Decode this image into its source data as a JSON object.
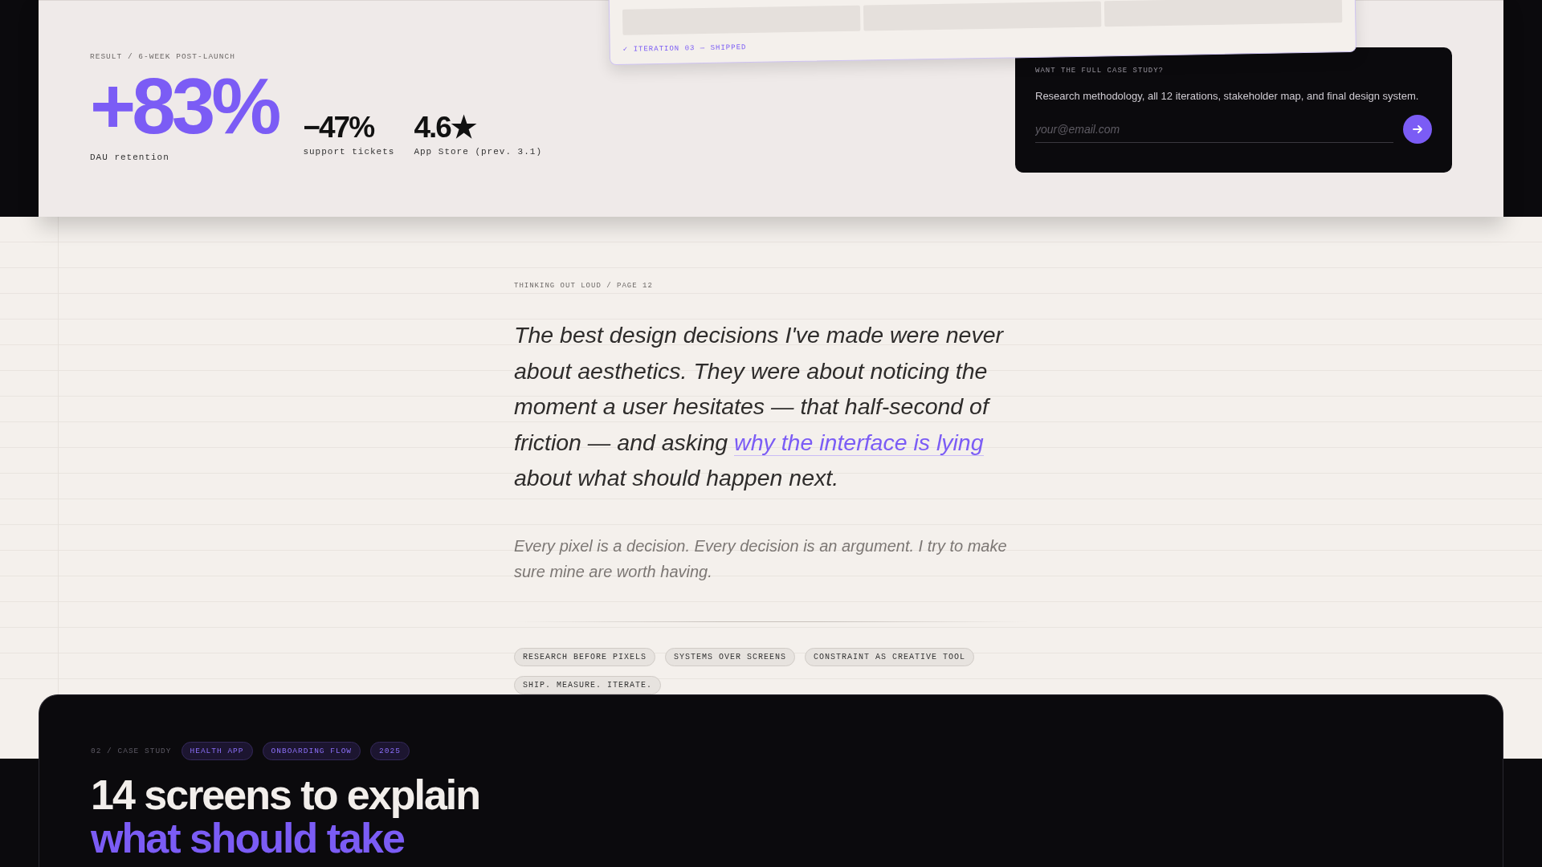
{
  "result": {
    "label": "RESULT / 6-WEEK POST-LAUNCH",
    "headline": {
      "value": "+83%",
      "caption": "DAU retention"
    },
    "stats": [
      {
        "value": "−47%",
        "caption": "support tickets"
      },
      {
        "value": "4.6★",
        "caption": "App Store (prev. 3.1)"
      }
    ]
  },
  "iteration_card": {
    "status": "✓ ITERATION 03 — SHIPPED"
  },
  "cta": {
    "title": "WANT THE FULL CASE STUDY?",
    "text": "Research methodology, all 12 iterations, stakeholder map, and final design system.",
    "email": {
      "placeholder": "your@email.com"
    }
  },
  "notes": {
    "label": "THINKING OUT LOUD / PAGE 12",
    "quote": {
      "before": "The best design decisions I've made were never about aesthetics. They were about noticing the moment a user hesitates — that half-second of friction — and asking",
      "link": "why the interface is lying",
      "after": "about what should happen next."
    },
    "aside": "Every pixel is a decision. Every decision is an argument. I try to make sure mine are worth having.",
    "tags": [
      "RESEARCH BEFORE PIXELS",
      "SYSTEMS OVER SCREENS",
      "CONSTRAINT AS CREATIVE TOOL",
      "SHIP. MEASURE. ITERATE."
    ]
  },
  "case_study": {
    "label": "02 / CASE STUDY",
    "tags": [
      "HEALTH APP",
      "ONBOARDING FLOW",
      "2025"
    ],
    "title": "14 screens to explain",
    "title_accent": "what should take"
  }
}
